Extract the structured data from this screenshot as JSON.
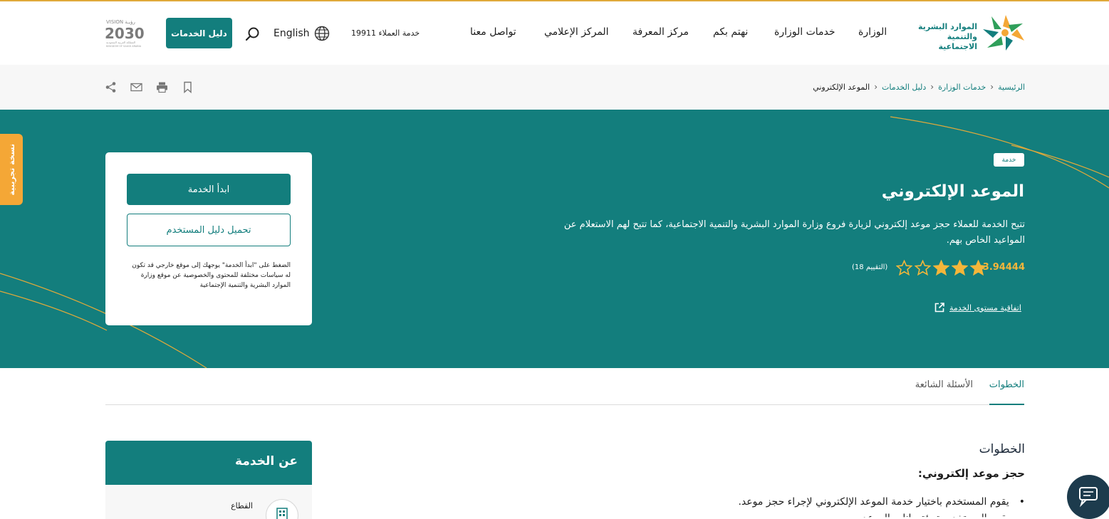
{
  "header": {
    "logo_text_line1": "الموارد البشرية",
    "logo_text_line2": "والتنمية الاجتماعية",
    "nav": [
      "الوزارة",
      "خدمات الوزارة",
      "نهتم بكم",
      "مركز المعرفة",
      "المركز الإعلامي",
      "تواصل معنا"
    ],
    "hotline": "خدمة العملاء 19911",
    "language": "English",
    "guide_button": "دليل الخدمات",
    "vision_text": "VISION رؤيـة",
    "vision_year": "2030",
    "vision_caption": "المملكة العربية السعودية",
    "vision_caption_en": "KINGDOM OF SAUDI ARABIA"
  },
  "breadcrumb": [
    "الرئيسية",
    "خدمات الوزارة",
    "دليل الخدمات",
    "الموعد الإلكتروني"
  ],
  "tools": [
    "bookmark-icon",
    "print-icon",
    "mail-icon",
    "share-icon"
  ],
  "beta_tab": "نسخة تجريبية",
  "service": {
    "tag": "خدمة",
    "title": "الموعد الإلكتروني",
    "description": "تتيح الخدمة للعملاء حجز موعد إلكتروني لزيارة فروع وزارة الموارد البشرية والتنمية الاجتماعية، كما تتيح لهم الاستعلام عن المواعيد الخاص بهم.",
    "rating_value": "3.94444",
    "rating_fraction": 0.6,
    "stars_filled": 3,
    "stars_total": 5,
    "rating_count": "(التقييم 18)",
    "sla_link": "اتفاقية مستوى الخدمة"
  },
  "card": {
    "start_button": "ابدأ الخدمة",
    "download_button": "تحميل دليل المستخدم",
    "note": "الضغط على \"ابدأ الخدمة\" يوجهك إلى موقع خارجي قد تكون له سياسات مختلفة للمحتوى والخصوصية عن موقع وزارة الموارد البشرية والتنمية الإجتماعية"
  },
  "tabs": [
    {
      "label": "الخطوات",
      "active": true
    },
    {
      "label": "الأسئلة الشائعة",
      "active": false
    }
  ],
  "content": {
    "heading": "الخطوات",
    "subheading": "حجز موعد إلكتروني:",
    "bullets": [
      "يقوم المستخدم باختيار خدمة الموعد الإلكتروني لإجراء حجز موعد.",
      "يقوم المستخدم بتعبئة بيانات الموعد"
    ]
  },
  "about": {
    "title": "عن الخدمة",
    "sector_label": "القطاع"
  },
  "colors": {
    "brand": "#137e7d",
    "accent": "#f4a736",
    "star": "#f4b63a"
  }
}
